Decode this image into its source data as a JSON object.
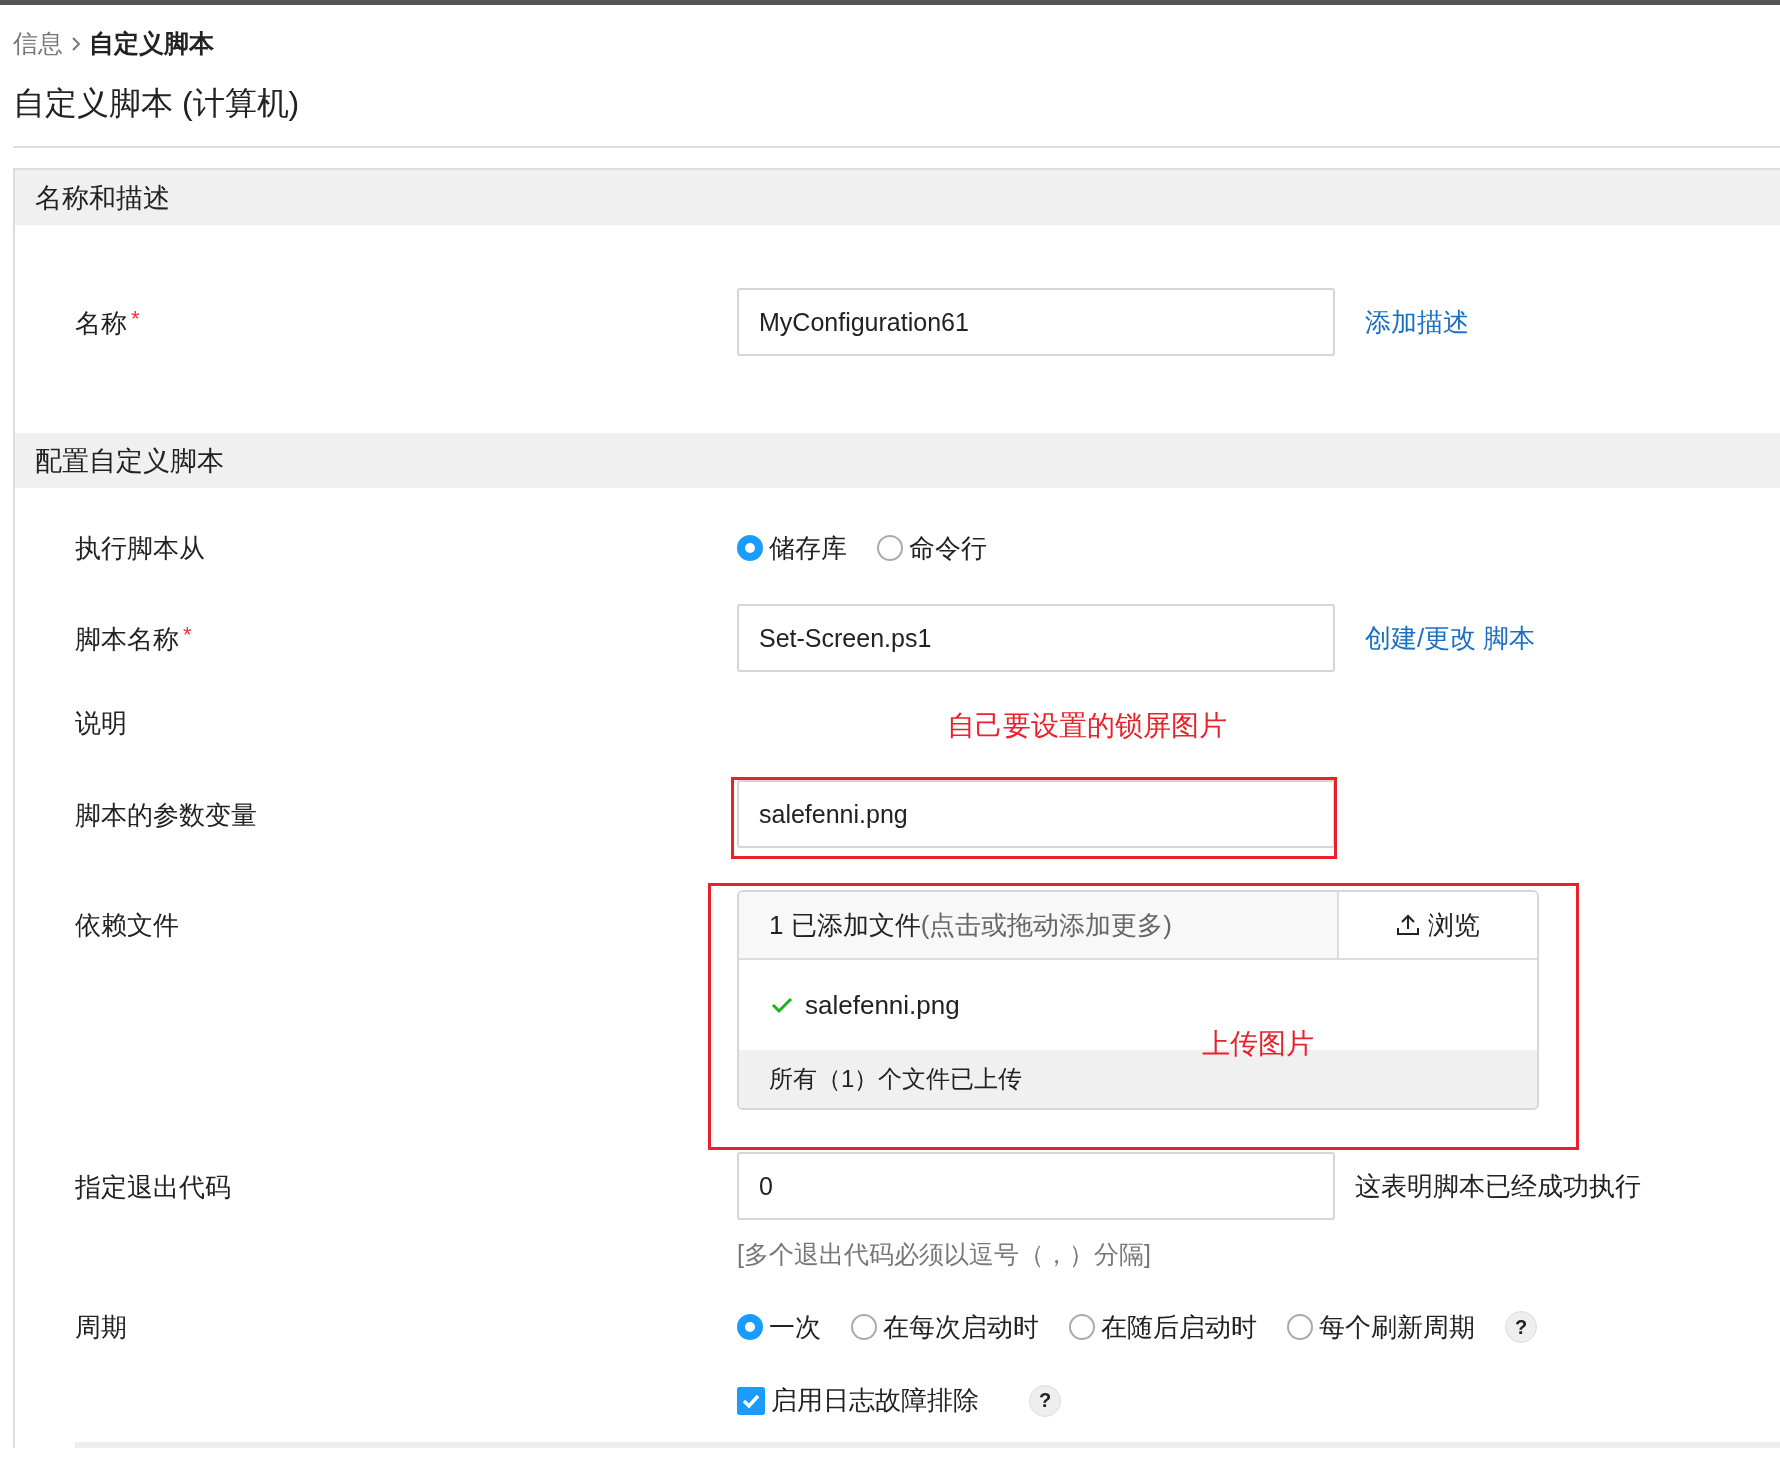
{
  "breadcrumb": [
    {
      "label": "信息",
      "current": false
    },
    {
      "label": "自定义脚本",
      "current": true
    }
  ],
  "page_title": "自定义脚本 (计算机)",
  "sections": [
    {
      "title": "名称和描述",
      "rows": [
        {
          "kind": "input",
          "label": "名称",
          "required_mark": "*",
          "value": "MyConfiguration61",
          "link": "添加描述"
        }
      ]
    },
    {
      "title": "配置自定义脚本",
      "rows": [
        {
          "kind": "radio",
          "label": "执行脚本从",
          "options": [
            {
              "label": "储存库",
              "selected": true
            },
            {
              "label": "命令行",
              "selected": false
            }
          ]
        },
        {
          "kind": "input",
          "label": "脚本名称",
          "required_mark": "*",
          "value": "Set-Screen.ps1",
          "link": "创建/更改 脚本"
        },
        {
          "kind": "empty",
          "label": "说明"
        },
        {
          "kind": "input",
          "label": "脚本的参数变量",
          "value": "salefenni.png",
          "annotation": "自己要设置的锁屏图片"
        },
        {
          "kind": "file",
          "label": "依赖文件",
          "count": "1 已添加文件",
          "hint": "(点击或拖动添加更多)",
          "browse": "浏览",
          "files": [
            {
              "name": "salefenni.png"
            }
          ],
          "status": "所有（1）个文件已上传",
          "annotation": "上传图片"
        },
        {
          "kind": "input",
          "label": "指定退出代码",
          "value": "0",
          "note": "这表明脚本已经成功执行",
          "help_text": "[多个退出代码必须以逗号（，）分隔]"
        },
        {
          "kind": "radio",
          "label": "周期",
          "help_mark": "?",
          "options": [
            {
              "label": "一次",
              "selected": true
            },
            {
              "label": "在每次启动时",
              "selected": false
            },
            {
              "label": "在随后启动时",
              "selected": false
            },
            {
              "label": "每个刷新周期",
              "selected": false
            }
          ]
        },
        {
          "kind": "checkbox",
          "label": "启用日志故障排除",
          "checked": true,
          "help_mark": "?"
        }
      ]
    }
  ]
}
